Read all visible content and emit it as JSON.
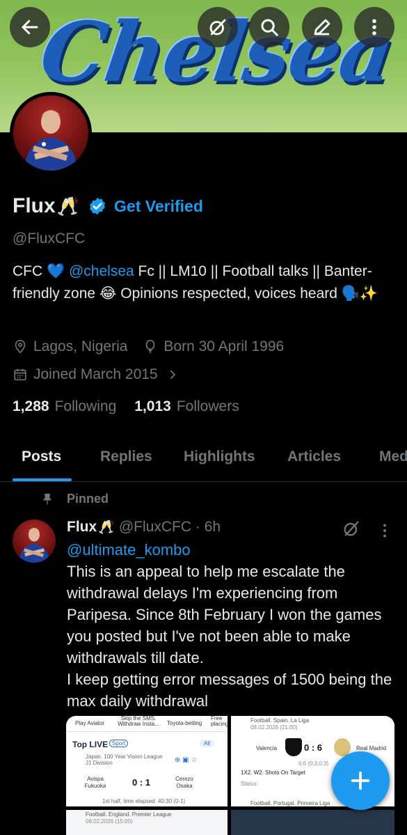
{
  "banner": {
    "word": "Chelsea"
  },
  "profile": {
    "name": "Flux",
    "name_emoji": "🥂",
    "get_verified": "Get Verified",
    "handle": "@FluxCFC",
    "bio_1": "CFC 💙 ",
    "bio_mention": "@chelsea",
    "bio_2": " Fc || LM10 || Football talks || Banter-friendly zone 😂 Opinions respected, voices heard 🗣️✨",
    "location": "Lagos, Nigeria",
    "birthday": "Born 30 April 1996",
    "joined": "Joined March 2015",
    "following_count": "1,288",
    "following_label": "Following",
    "followers_count": "1,013",
    "followers_label": "Followers"
  },
  "tabs": [
    "Posts",
    "Replies",
    "Highlights",
    "Articles",
    "Media"
  ],
  "post": {
    "pinned_label": "Pinned",
    "name": "Flux",
    "name_emoji": "🥂",
    "handle_time": "@FluxCFC · 6h",
    "mention": "@ultimate_kombo",
    "text_1": "This is an appeal to help me escalate the withdrawal delays I'm experiencing from Paripesa. Since 8th February I won the games you posted but I've not been able to make withdrawals till date.",
    "text_2": "I keep getting error messages of 1500 being the max daily withdrawal"
  },
  "media": {
    "m1_tabs": [
      "Play Aviator",
      "Skip the SMS. Withdraw Insta...",
      "Toyota-betting",
      "Free placing"
    ],
    "m1_top_live": "Top LIVE",
    "m1_sport": "Sport",
    "m1_all": "All",
    "m1_league": "Japan. 100 Year Vision League J1 Division",
    "m1_team1": "Avispa Fukuoka",
    "m1_score": "0 : 1",
    "m1_team2": "Cerezo Osaka",
    "m1_time": "1st half, time elapsed: 40:30 (0-1)",
    "m2_league": "Football. Spain. La Liga",
    "m2_date": "08.02.2026 (21:00)",
    "m2_team1": "Valencia",
    "m2_score": "0 : 6",
    "m2_team2": "Real Madrid",
    "m2_sub": "0:6 (0:3,0:3)",
    "m2_market": "1X2. W2. Shots On Target",
    "m2_status": "Status:",
    "m2_next": "Football. Portugal. Primeira Liga",
    "m3_league": "Football. England. Premier League",
    "m3_date": "08.02.2026 (15:00)"
  },
  "colors": {
    "accent": "#1d9bf0",
    "text": "#e7e9ea",
    "muted": "#71767b",
    "background": "#000000"
  }
}
